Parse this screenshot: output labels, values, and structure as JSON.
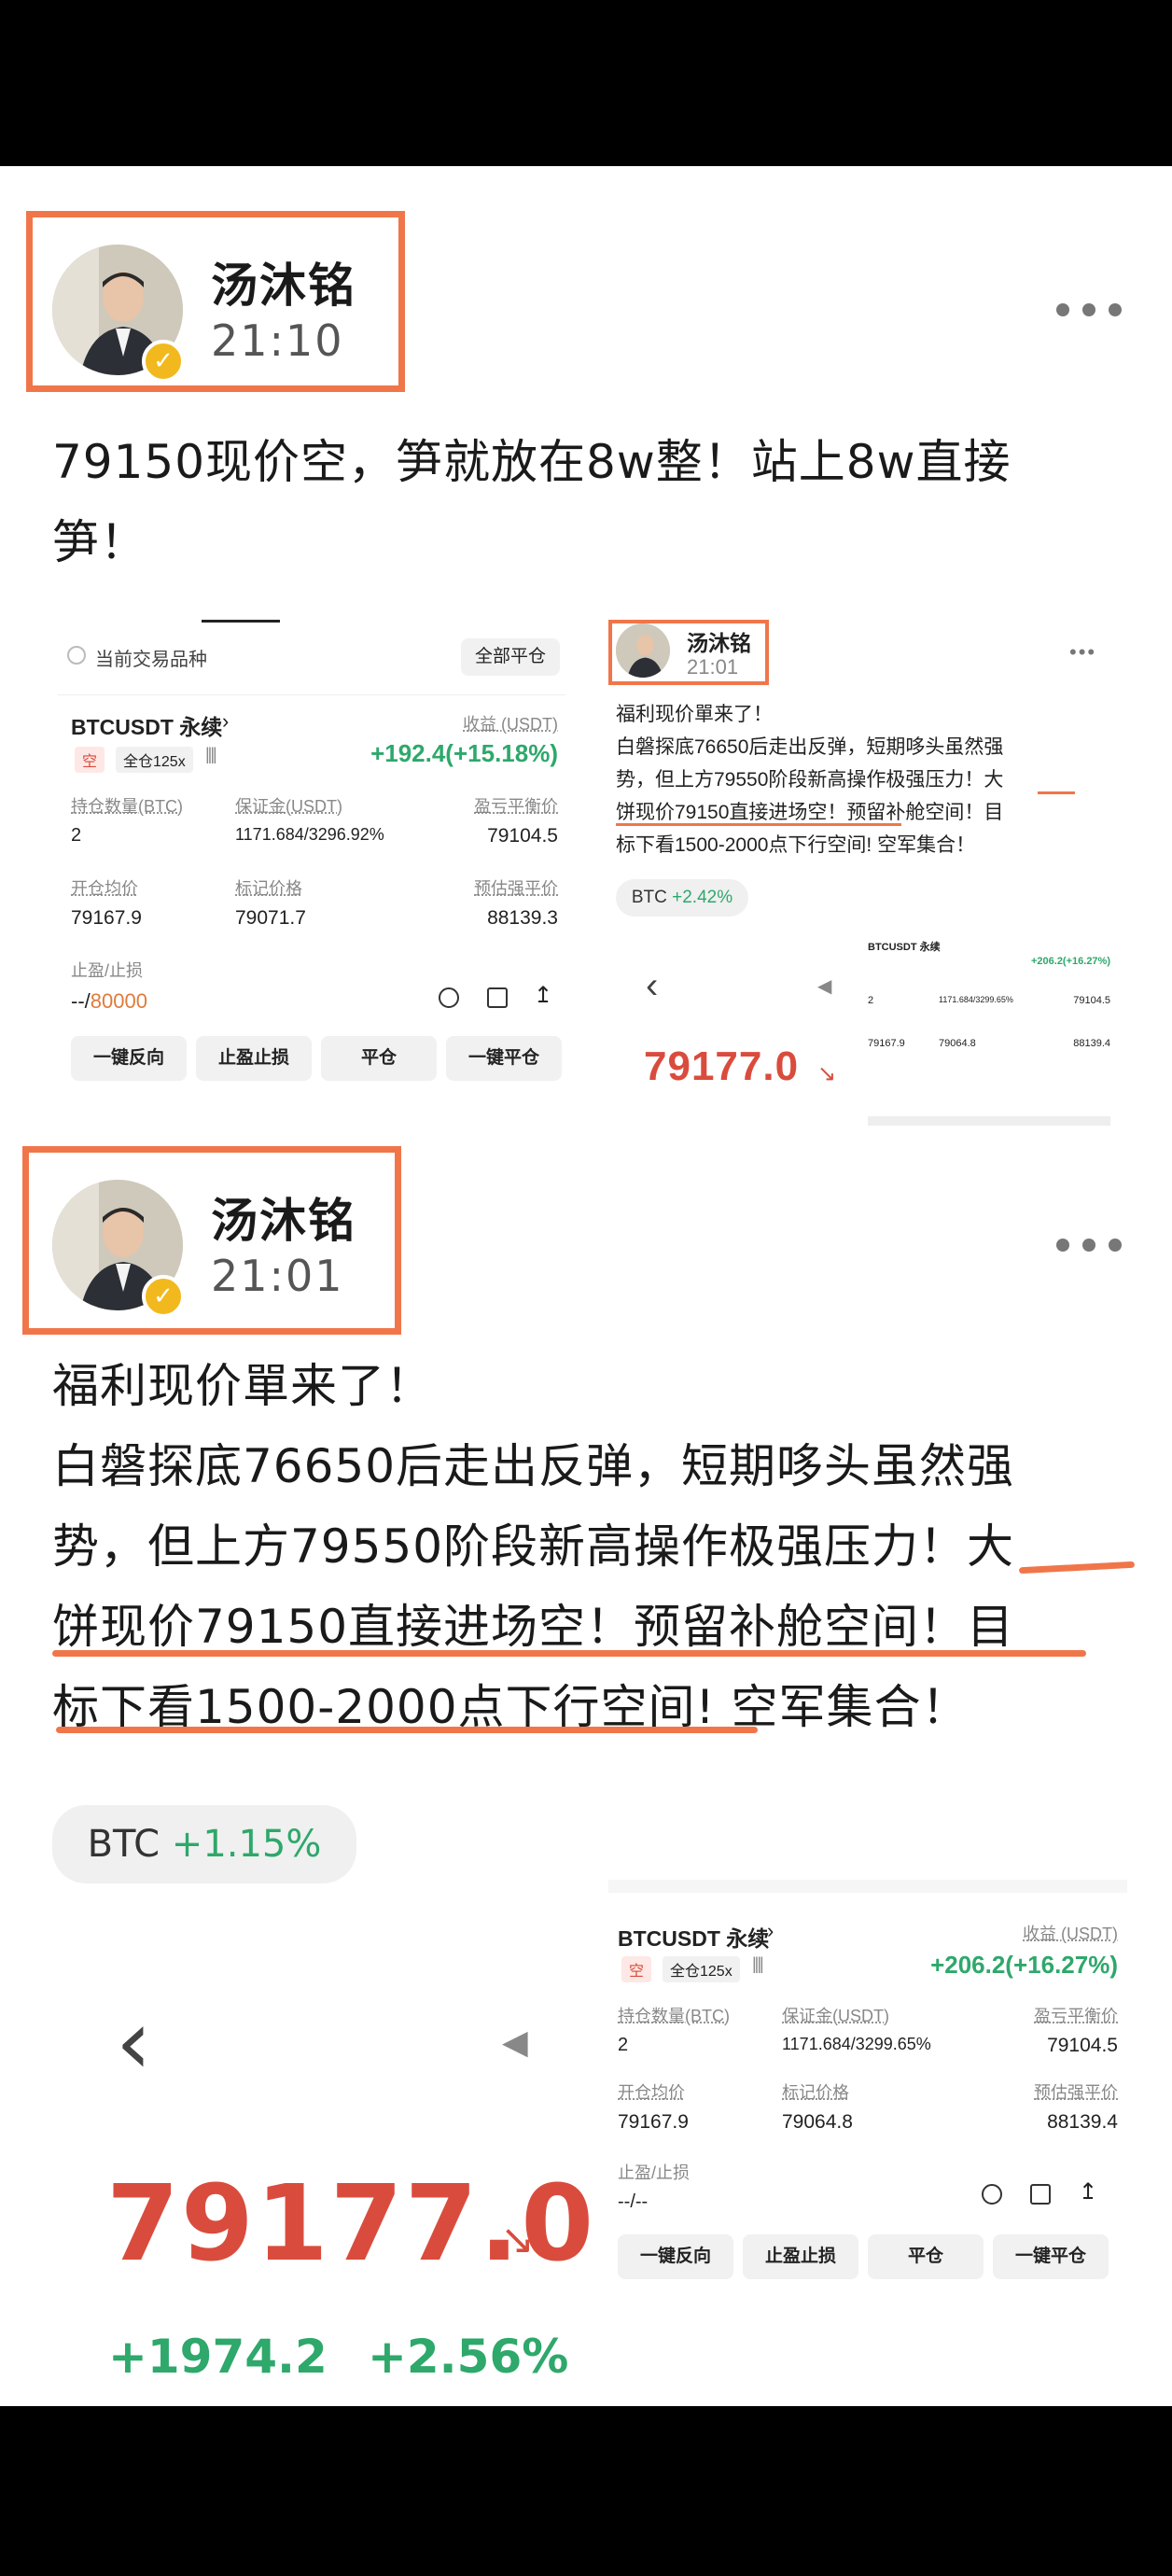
{
  "post1": {
    "author": "汤沐铭",
    "time": "21:10",
    "text_lines": [
      "79150现价空，笋就放在8w整！站上8w直接",
      "笋！"
    ],
    "card": {
      "current_pair_label": "当前交易品种",
      "close_all_label": "全部平仓",
      "symbol": "BTCUSDT 永续",
      "side": "空",
      "leverage": "全仓125x",
      "pnl_label": "收益 (USDT)",
      "pnl_value": "+192.4(+15.18%)",
      "qty_label": "持仓数量(BTC)",
      "qty_value": "2",
      "margin_label": "保证金(USDT)",
      "margin_value": "1171.684/3296.92%",
      "breakeven_label": "盈亏平衡价",
      "breakeven_value": "79104.5",
      "entry_label": "开仓均价",
      "entry_value": "79167.9",
      "mark_label": "标记价格",
      "mark_value": "79071.7",
      "liq_label": "预估强平价",
      "liq_value": "88139.3",
      "tpsl_label": "止盈/止损",
      "tpsl_value_prefix": "--/",
      "tpsl_value": "80000",
      "buttons": [
        "一键反向",
        "止盈止损",
        "平仓",
        "一键平仓"
      ]
    },
    "mini": {
      "author": "汤沐铭",
      "time": "21:01",
      "lines": [
        "福利现价單来了！",
        "白磐探底76650后走出反弹，短期哆头虽然强",
        "势，但上方79550阶段新高操作极强压力！大",
        "饼现价79150直接进场空！预留补舱空间！目",
        "标下看1500-2000点下行空间! 空军集合！"
      ],
      "tag_coin": "BTC",
      "tag_change": "+2.42%",
      "price": "79177.0",
      "card_symbol": "BTCUSDT 永续",
      "card_pnl": "+206.2(+16.27%)",
      "card_values": [
        "2",
        "1171.684/3299.65%",
        "79104.5",
        "79167.9",
        "79064.8",
        "88139.4"
      ]
    }
  },
  "post2": {
    "author": "汤沐铭",
    "time": "21:01",
    "text_lines": [
      "福利现价單来了！",
      "白磐探底76650后走出反弹，短期哆头虽然强",
      "势，但上方79550阶段新高操作极强压力！大",
      "饼现价79150直接进场空！预留补舱空间！目",
      "标下看1500-2000点下行空间! 空军集合！"
    ],
    "tag_coin": "BTC",
    "tag_change": "+1.15%",
    "price": "79177.0",
    "price_change": "+1974.2",
    "price_change_pct": "+2.56%",
    "card": {
      "symbol": "BTCUSDT 永续",
      "side": "空",
      "leverage": "全仓125x",
      "pnl_label": "收益 (USDT)",
      "pnl_value": "+206.2(+16.27%)",
      "qty_label": "持仓数量(BTC)",
      "qty_value": "2",
      "margin_label": "保证金(USDT)",
      "margin_value": "1171.684/3299.65%",
      "breakeven_label": "盈亏平衡价",
      "breakeven_value": "79104.5",
      "entry_label": "开仓均价",
      "entry_value": "79167.9",
      "mark_label": "标记价格",
      "mark_value": "79064.8",
      "liq_label": "预估强平价",
      "liq_value": "88139.4",
      "tpsl_label": "止盈/止损",
      "tpsl_value": "--/--",
      "buttons": [
        "一键反向",
        "止盈止损",
        "平仓",
        "一键平仓"
      ]
    }
  },
  "colors": {
    "highlight": "#f0764a",
    "green": "#2ea86b",
    "red": "#d94c3d"
  }
}
